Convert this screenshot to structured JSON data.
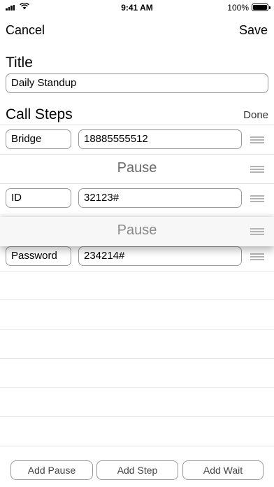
{
  "status_bar": {
    "time": "9:41 AM",
    "battery_text": "100%"
  },
  "nav": {
    "cancel_label": "Cancel",
    "save_label": "Save"
  },
  "title_section": {
    "label": "Title",
    "value": "Daily Standup"
  },
  "steps_section": {
    "label": "Call Steps",
    "done_label": "Done"
  },
  "steps": [
    {
      "type": "step",
      "name": "Bridge",
      "value": "18885555512"
    },
    {
      "type": "pause",
      "label": "Pause"
    },
    {
      "type": "step",
      "name": "ID",
      "value": "32123#"
    },
    {
      "type": "pause",
      "label": "Pause",
      "dragging": true
    },
    {
      "type": "step",
      "name": "Password",
      "value": "234214#"
    }
  ],
  "toolbar": {
    "add_pause_label": "Add Pause",
    "add_step_label": "Add Step",
    "add_wait_label": "Add Wait"
  }
}
